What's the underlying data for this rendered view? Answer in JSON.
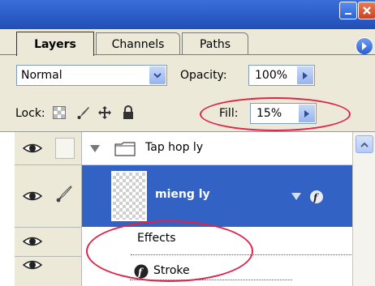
{
  "window": {
    "minimize_label": "minimize",
    "close_label": "close"
  },
  "tabs": [
    {
      "label": "Layers",
      "active": true
    },
    {
      "label": "Channels",
      "active": false
    },
    {
      "label": "Paths",
      "active": false
    }
  ],
  "blend": {
    "mode": "Normal",
    "opacity_label": "Opacity:",
    "opacity_value": "100%"
  },
  "lock": {
    "label": "Lock:",
    "icons": [
      "transparent-pixels-lock-icon",
      "brush-lock-icon",
      "move-lock-icon",
      "padlock-icon"
    ],
    "fill_label": "Fill:",
    "fill_value": "15%"
  },
  "layers": {
    "group": {
      "name": "Tap hop ly"
    },
    "selected_layer": {
      "name": "mieng ly"
    },
    "effects": {
      "label": "Effects",
      "items": [
        {
          "label": "Stroke"
        }
      ]
    }
  },
  "colors": {
    "selection": "#3162c4",
    "highlight_ellipse": "#e0234b",
    "panel_bg": "#ece9d8"
  }
}
